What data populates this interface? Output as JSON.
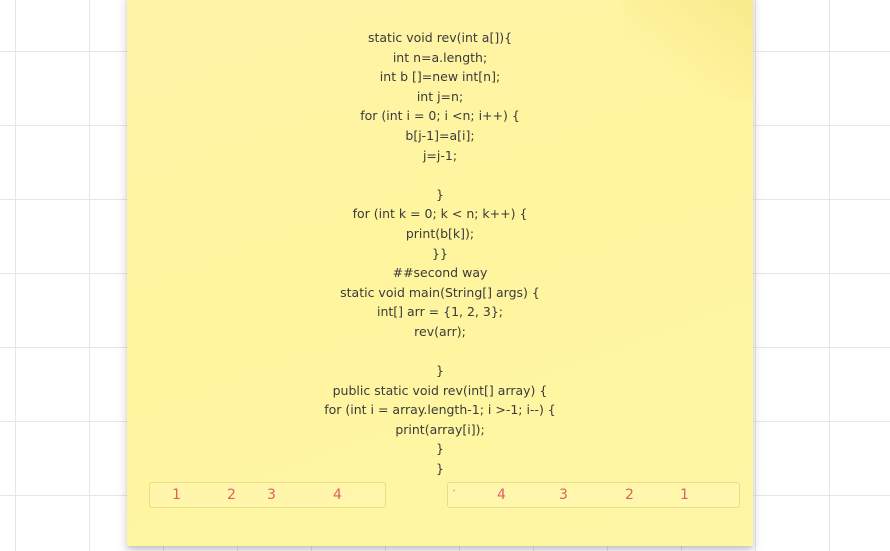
{
  "note": {
    "lines": [
      "static void rev(int a[]){",
      "int n=a.length;",
      "int b []=new int[n];",
      "int j=n;",
      "for (int i = 0; i <n; i++) {",
      "b[j-1]=a[i];",
      "j=j-1;",
      "",
      "}",
      "for (int k = 0; k < n; k++) {",
      "print(b[k]);",
      "}}",
      "##second way",
      "static void main(String[] args) {",
      "int[] arr = {1, 2, 3};",
      "rev(arr);",
      "",
      "}",
      "public static void rev(int[] array) {",
      "for (int i = array.length-1; i >-1; i--) {",
      "print(array[i]);",
      "}",
      "}"
    ]
  },
  "input_array": {
    "values": [
      "1",
      "2",
      "3",
      "4"
    ]
  },
  "output_array": {
    "values": [
      "4",
      "3",
      "2",
      "1"
    ]
  },
  "colors": {
    "note_background": "#fff59e",
    "number_color": "#e06060",
    "text_color": "#3a3a3a"
  }
}
